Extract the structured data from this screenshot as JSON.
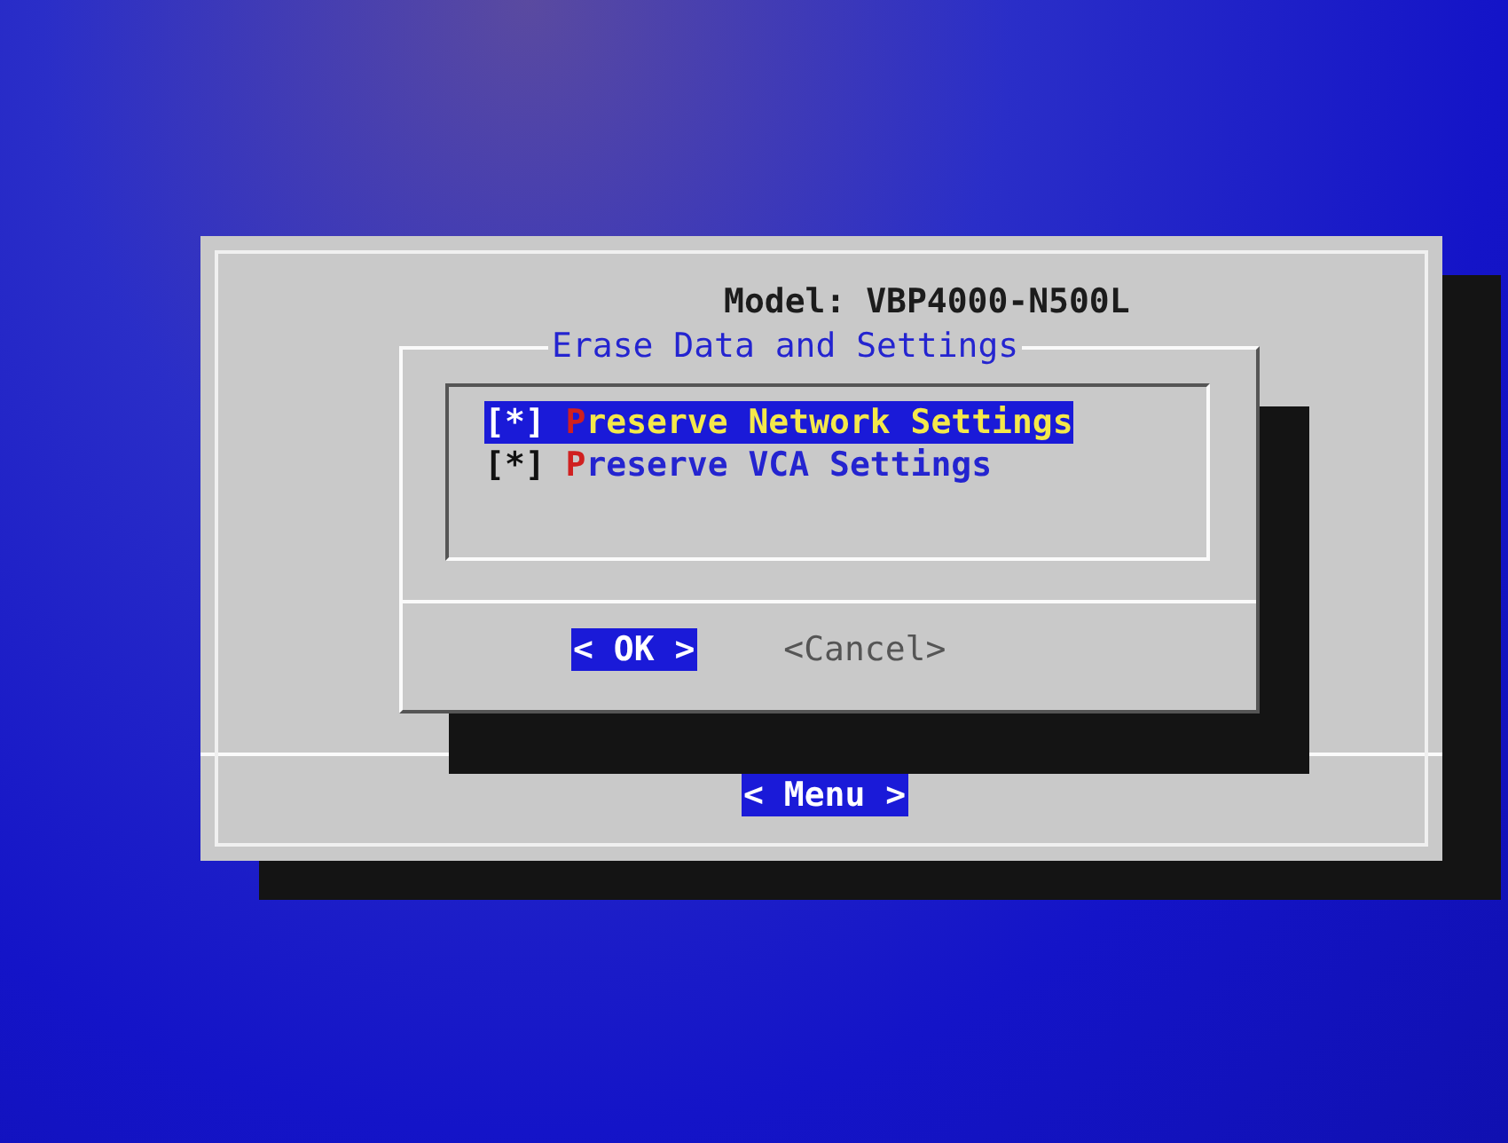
{
  "dialog": {
    "model": "Model: VBP4000-N500L",
    "title": "Erase Data and Settings",
    "options": [
      {
        "mark": "[*]",
        "label": "Preserve Network Settings",
        "checked": true,
        "selected": true
      },
      {
        "mark": "[*]",
        "label": "Preserve VCA Settings",
        "checked": true,
        "selected": false
      }
    ],
    "buttons": [
      {
        "label": "< OK >",
        "selected": true
      },
      {
        "label": "<Cancel>",
        "selected": false
      }
    ]
  },
  "menu_button": {
    "label": "< Menu >",
    "selected": true
  }
}
